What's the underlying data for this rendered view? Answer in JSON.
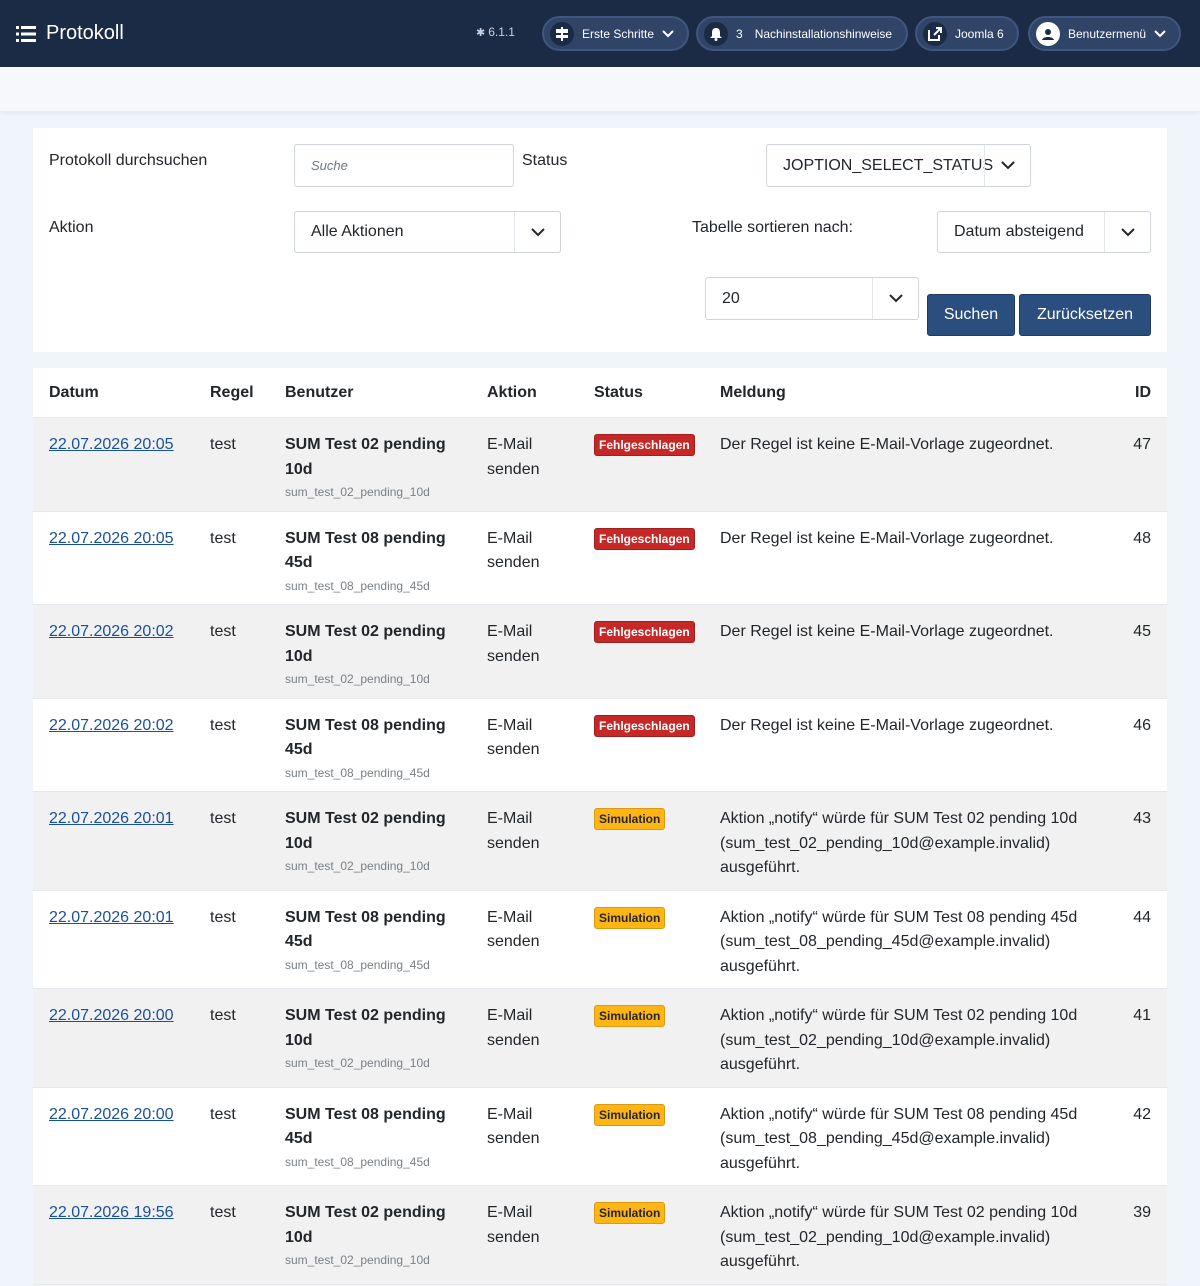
{
  "header": {
    "title": "Protokoll",
    "version": "6.1.1",
    "buttons": {
      "getting_started": "Erste Schritte",
      "notif_count": "3",
      "post_install": "Nachinstallationshinweise",
      "site": "Joomla 6",
      "user_menu": "Benutzermenü"
    }
  },
  "filters": {
    "search_label": "Protokoll durchsuchen",
    "search_placeholder": "Suche",
    "status_label": "Status",
    "status_value": "JOPTION_SELECT_STATUS",
    "action_label": "Aktion",
    "action_value": "Alle Aktionen",
    "sort_label": "Tabelle sortieren nach:",
    "sort_value": "Datum absteigend",
    "limit_value": "20",
    "search_button": "Suchen",
    "reset_button": "Zurücksetzen"
  },
  "table": {
    "columns": {
      "date": "Datum",
      "rule": "Regel",
      "user": "Benutzer",
      "action": "Aktion",
      "status": "Status",
      "message": "Meldung",
      "id": "ID"
    },
    "rows": [
      {
        "date": "22.07.2026 20:05",
        "rule": "test",
        "user_l1": "SUM Test 02 pending",
        "user_l2": "10d",
        "username": "sum_test_02_pending_10d",
        "action_l1": "E-Mail",
        "action_l2": "senden",
        "status": "Fehlgeschlagen",
        "status_type": "fail",
        "msg_l1": "Der Regel ist keine E-Mail-Vorlage zugeordnet.",
        "msg_l2": "",
        "msg_l3": "",
        "id": "47"
      },
      {
        "date": "22.07.2026 20:05",
        "rule": "test",
        "user_l1": "SUM Test 08 pending",
        "user_l2": "45d",
        "username": "sum_test_08_pending_45d",
        "action_l1": "E-Mail",
        "action_l2": "senden",
        "status": "Fehlgeschlagen",
        "status_type": "fail",
        "msg_l1": "Der Regel ist keine E-Mail-Vorlage zugeordnet.",
        "msg_l2": "",
        "msg_l3": "",
        "id": "48"
      },
      {
        "date": "22.07.2026 20:02",
        "rule": "test",
        "user_l1": "SUM Test 02 pending",
        "user_l2": "10d",
        "username": "sum_test_02_pending_10d",
        "action_l1": "E-Mail",
        "action_l2": "senden",
        "status": "Fehlgeschlagen",
        "status_type": "fail",
        "msg_l1": "Der Regel ist keine E-Mail-Vorlage zugeordnet.",
        "msg_l2": "",
        "msg_l3": "",
        "id": "45"
      },
      {
        "date": "22.07.2026 20:02",
        "rule": "test",
        "user_l1": "SUM Test 08 pending",
        "user_l2": "45d",
        "username": "sum_test_08_pending_45d",
        "action_l1": "E-Mail",
        "action_l2": "senden",
        "status": "Fehlgeschlagen",
        "status_type": "fail",
        "msg_l1": "Der Regel ist keine E-Mail-Vorlage zugeordnet.",
        "msg_l2": "",
        "msg_l3": "",
        "id": "46"
      },
      {
        "date": "22.07.2026 20:01",
        "rule": "test",
        "user_l1": "SUM Test 02 pending",
        "user_l2": "10d",
        "username": "sum_test_02_pending_10d",
        "action_l1": "E-Mail",
        "action_l2": "senden",
        "status": "Simulation",
        "status_type": "sim",
        "msg_l1": "Aktion „notify“ würde für SUM Test 02 pending 10d",
        "msg_l2": "(sum_test_02_pending_10d@example.invalid)",
        "msg_l3": "ausgeführt.",
        "id": "43"
      },
      {
        "date": "22.07.2026 20:01",
        "rule": "test",
        "user_l1": "SUM Test 08 pending",
        "user_l2": "45d",
        "username": "sum_test_08_pending_45d",
        "action_l1": "E-Mail",
        "action_l2": "senden",
        "status": "Simulation",
        "status_type": "sim",
        "msg_l1": "Aktion „notify“ würde für SUM Test 08 pending 45d",
        "msg_l2": "(sum_test_08_pending_45d@example.invalid)",
        "msg_l3": "ausgeführt.",
        "id": "44"
      },
      {
        "date": "22.07.2026 20:00",
        "rule": "test",
        "user_l1": "SUM Test 02 pending",
        "user_l2": "10d",
        "username": "sum_test_02_pending_10d",
        "action_l1": "E-Mail",
        "action_l2": "senden",
        "status": "Simulation",
        "status_type": "sim",
        "msg_l1": "Aktion „notify“ würde für SUM Test 02 pending 10d",
        "msg_l2": "(sum_test_02_pending_10d@example.invalid)",
        "msg_l3": "ausgeführt.",
        "id": "41"
      },
      {
        "date": "22.07.2026 20:00",
        "rule": "test",
        "user_l1": "SUM Test 08 pending",
        "user_l2": "45d",
        "username": "sum_test_08_pending_45d",
        "action_l1": "E-Mail",
        "action_l2": "senden",
        "status": "Simulation",
        "status_type": "sim",
        "msg_l1": "Aktion „notify“ würde für SUM Test 08 pending 45d",
        "msg_l2": "(sum_test_08_pending_45d@example.invalid)",
        "msg_l3": "ausgeführt.",
        "id": "42"
      },
      {
        "date": "22.07.2026 19:56",
        "rule": "test",
        "user_l1": "SUM Test 02 pending",
        "user_l2": "10d",
        "username": "sum_test_02_pending_10d",
        "action_l1": "E-Mail",
        "action_l2": "senden",
        "status": "Simulation",
        "status_type": "sim",
        "msg_l1": "Aktion „notify“ würde für SUM Test 02 pending 10d",
        "msg_l2": "(sum_test_02_pending_10d@example.invalid)",
        "msg_l3": "ausgeführt.",
        "id": "39"
      }
    ]
  }
}
